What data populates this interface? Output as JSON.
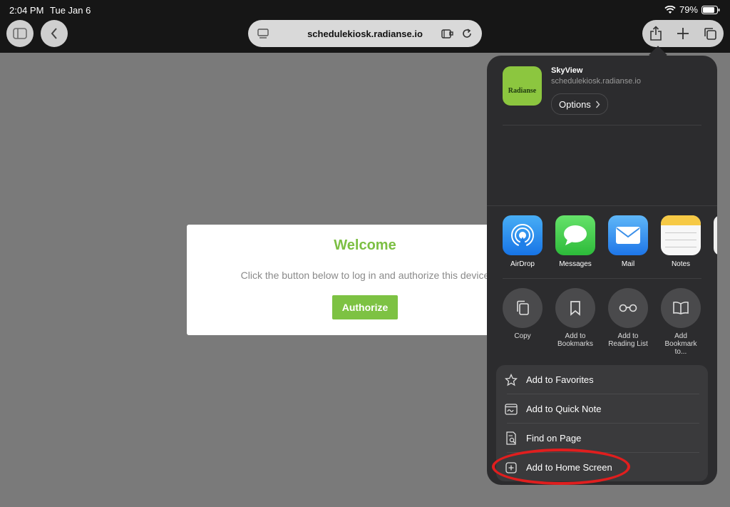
{
  "status": {
    "time": "2:04 PM",
    "date": "Tue Jan 6",
    "battery": "79%"
  },
  "browser": {
    "url": "schedulekiosk.radianse.io"
  },
  "page": {
    "title": "Welcome",
    "message": "Click the button below to log in and authorize this device",
    "button": "Authorize"
  },
  "share": {
    "app_name": "SkyView",
    "app_url": "schedulekiosk.radianse.io",
    "logo_text": "Radianse",
    "options_label": "Options",
    "apps": [
      {
        "label": "AirDrop"
      },
      {
        "label": "Messages"
      },
      {
        "label": "Mail"
      },
      {
        "label": "Notes"
      }
    ],
    "actions": [
      {
        "label": "Copy"
      },
      {
        "label": "Add to Bookmarks"
      },
      {
        "label": "Add to Reading List"
      },
      {
        "label": "Add Bookmark to..."
      }
    ],
    "list": [
      {
        "label": "Add to Favorites"
      },
      {
        "label": "Add to Quick Note"
      },
      {
        "label": "Find on Page"
      },
      {
        "label": "Add to Home Screen"
      }
    ]
  },
  "colors": {
    "accent_green": "#7dc243",
    "highlight_red": "#e01e1e"
  }
}
